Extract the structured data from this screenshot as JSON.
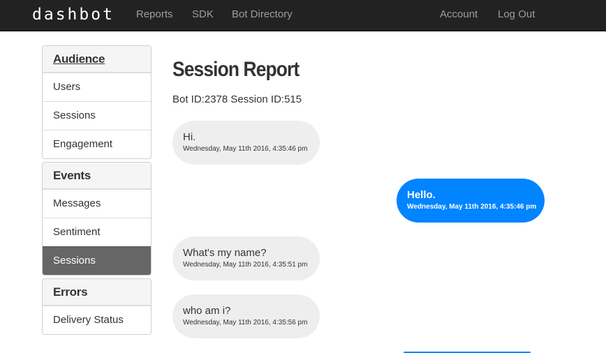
{
  "navbar": {
    "brand": "dashbot",
    "links": [
      "Reports",
      "SDK",
      "Bot Directory"
    ],
    "right_links": [
      "Account",
      "Log Out"
    ],
    "background": "#222222"
  },
  "sidebar": {
    "sections": [
      {
        "heading": "Audience",
        "items": [
          "Users",
          "Sessions",
          "Engagement"
        ]
      },
      {
        "heading": "Events",
        "items": [
          "Messages",
          "Sentiment",
          "Sessions"
        ],
        "active": "Sessions"
      },
      {
        "heading": "Errors",
        "items": [
          "Delivery Status"
        ]
      }
    ]
  },
  "main": {
    "title": "Session Report",
    "subtitle": "Bot ID:2378 Session ID:515",
    "messages": [
      {
        "sender": "bot",
        "text": "Hi.",
        "time": "Wednesday, May 11th 2016, 4:35:46 pm"
      },
      {
        "sender": "user",
        "text": "Hello.",
        "time": "Wednesday, May 11th 2016, 4:35:46 pm"
      },
      {
        "sender": "bot",
        "text": "What's my name?",
        "time": "Wednesday, May 11th 2016, 4:35:51 pm"
      },
      {
        "sender": "bot",
        "text": "who am i?",
        "time": "Wednesday, May 11th 2016, 4:35:56 pm"
      }
    ]
  },
  "colors": {
    "user_bubble": "#0084ff",
    "bot_bubble": "#eeeeee",
    "active_item": "#666666"
  }
}
